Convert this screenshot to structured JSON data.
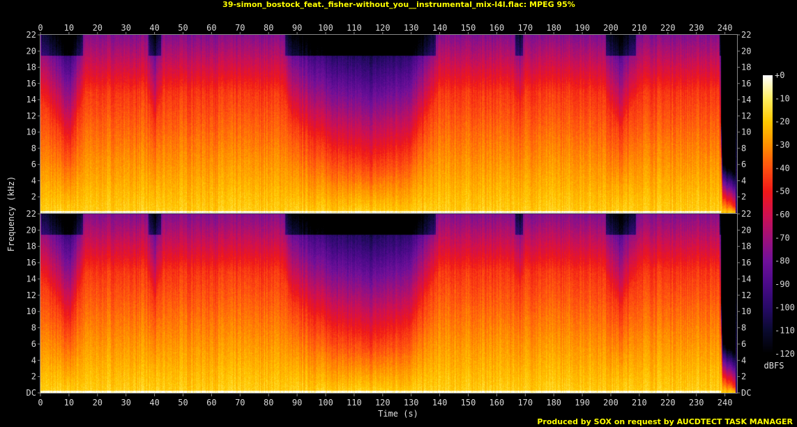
{
  "chart_data": {
    "type": "heatmap",
    "title": "39-simon_bostock_feat._fisher-without_you__instrumental_mix-l4l.flac: MPEG 95%",
    "xlabel": "Time (s)",
    "ylabel": "Frequency (kHz)",
    "xlim": [
      0,
      244
    ],
    "ylim": [
      0,
      22
    ],
    "channels": 2,
    "x_ticks": [
      "0",
      "10",
      "20",
      "30",
      "40",
      "50",
      "60",
      "70",
      "80",
      "90",
      "100",
      "110",
      "120",
      "130",
      "140",
      "150",
      "160",
      "170",
      "180",
      "190",
      "200",
      "210",
      "220",
      "230",
      "240"
    ],
    "y_ticks_top": [
      "22",
      "20",
      "18",
      "16",
      "14",
      "12",
      "10",
      "8",
      "6",
      "4",
      "2"
    ],
    "y_ticks_bottom": [
      "22",
      "20",
      "18",
      "16",
      "14",
      "12",
      "10",
      "8",
      "6",
      "4",
      "2",
      "DC"
    ],
    "colorbar": {
      "label": "dBFS",
      "range": [
        -120,
        0
      ],
      "ticks": [
        "+0",
        "-10",
        "-20",
        "-30",
        "-40",
        "-50",
        "-60",
        "-70",
        "-80",
        "-90",
        "-100",
        "-110",
        "-120"
      ]
    },
    "hf_extent_khz": [
      [
        0,
        14
      ],
      [
        2,
        13
      ],
      [
        10,
        8
      ],
      [
        15.5,
        15
      ],
      [
        37,
        15
      ],
      [
        40,
        11
      ],
      [
        43,
        15
      ],
      [
        85,
        15
      ],
      [
        88,
        11
      ],
      [
        100,
        8
      ],
      [
        115,
        6
      ],
      [
        130,
        8
      ],
      [
        140,
        15
      ],
      [
        165,
        15
      ],
      [
        168,
        13
      ],
      [
        170,
        15
      ],
      [
        197,
        15
      ],
      [
        203,
        10
      ],
      [
        210,
        15
      ],
      [
        238,
        15
      ],
      [
        239,
        2
      ],
      [
        244,
        0.5
      ]
    ],
    "colors": {
      "text_title": "#ffff00",
      "axis": "#d8d8d8"
    }
  },
  "footer": "Produced by SOX on request by AUCDTECT TASK MANAGER"
}
